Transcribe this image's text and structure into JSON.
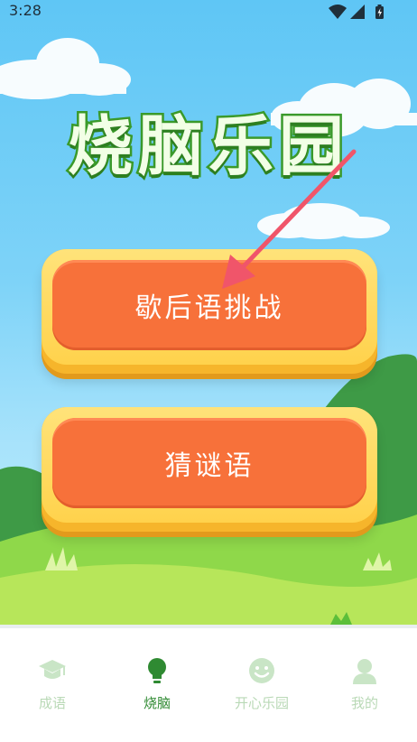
{
  "status_bar": {
    "time": "3:28",
    "icons": [
      "wifi-icon",
      "signal-icon",
      "battery-charging-icon"
    ]
  },
  "title": "烧脑乐园",
  "game_buttons": [
    {
      "label": "歇后语挑战"
    },
    {
      "label": "猜谜语"
    }
  ],
  "overlay": {
    "arrow_color": "#f0556a"
  },
  "colors": {
    "title_stroke": "#3a9a2a",
    "button_face": "#f7713a",
    "button_rim": "#ffd24c",
    "nav_active": "#2f8a32",
    "nav_inactive": "#b9d9b6"
  },
  "bottom_nav": {
    "items": [
      {
        "label": "成语",
        "icon": "graduation-cap-icon",
        "active": false
      },
      {
        "label": "烧脑",
        "icon": "lightbulb-icon",
        "active": true
      },
      {
        "label": "开心乐园",
        "icon": "smiley-icon",
        "active": false
      },
      {
        "label": "我的",
        "icon": "user-icon",
        "active": false
      }
    ]
  }
}
